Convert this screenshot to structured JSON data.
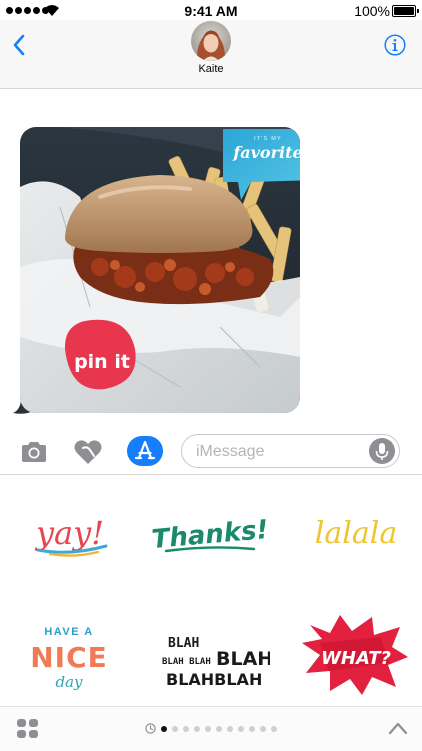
{
  "status": {
    "time": "9:41 AM",
    "battery": "100%"
  },
  "nav": {
    "contact": "Kaite"
  },
  "message_stickers": {
    "speech_small": "IT'S MY",
    "speech_big": "favorite",
    "badge": "pin it"
  },
  "composer": {
    "placeholder": "iMessage"
  },
  "stickers": {
    "yay": "yay!",
    "thanks": "Thanks!",
    "lalala": "lalala",
    "have_a": "HAVE A",
    "nice": "NICE",
    "day": "day",
    "blah1": "BLAH",
    "blah2a": "BLAH BLAH",
    "blah2b": "BLAH",
    "blah3": "BLAHBLAH",
    "what": "WHAT?"
  },
  "pager": {
    "total_pages": 11,
    "current_page": 1
  },
  "colors": {
    "accent": "#157efb"
  }
}
